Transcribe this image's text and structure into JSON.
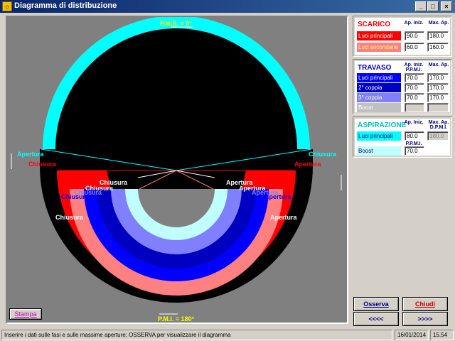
{
  "window": {
    "title": "Diagramma di distribuzione",
    "icon": "app-logo-icon",
    "minimize": "_",
    "maximize": "□",
    "close": "×"
  },
  "diagram": {
    "pms_label": "P.M.S. = 0°",
    "pmi_label": "P.M.I. = 180°",
    "left_aspirazione": "Apertura",
    "right_aspirazione": "Chiusura",
    "left_scarico": "Chiusura",
    "right_scarico": "Apertura",
    "white_close": "Chiusura",
    "white_open": "Apertura",
    "lightblue_close": "Chiusura",
    "lightblue_open": "Apertura",
    "blue_close": "Chiusura",
    "blue_open": "Apertura",
    "pink_close": "Chiusura",
    "pink_open": "Apertura",
    "print_button": "Stampa"
  },
  "scarico": {
    "title": "SCARICO",
    "col1": "Ap. Iniz.",
    "col2": "Max. Ap.",
    "rows": [
      {
        "label": "Luci principali",
        "color": "#ff0000",
        "text_color": "#ffffff",
        "ap_iniz": "90.0",
        "max_ap": "180.0"
      },
      {
        "label": "Luci secondarie",
        "color": "#ff8080",
        "text_color": "#ffff80",
        "ap_iniz": "60.0",
        "max_ap": "160.0"
      }
    ]
  },
  "travaso": {
    "title": "TRAVASO",
    "col1": "Ap. Iniz.",
    "col1b": "P.P.M.I.",
    "col2": "Max. Ap.",
    "rows": [
      {
        "label": "Luci principali",
        "color": "#0000ff",
        "text_color": "#ffffff",
        "ap_iniz": "70.0",
        "max_ap": "170.0",
        "disabled": false
      },
      {
        "label": "2° coppia",
        "color": "#0000c0",
        "text_color": "#ffffff",
        "ap_iniz": "70.0",
        "max_ap": "170.0",
        "disabled": false
      },
      {
        "label": "3° coppia",
        "color": "#8080ff",
        "text_color": "#ffff80",
        "ap_iniz": "70.0",
        "max_ap": "170.0",
        "disabled": false
      },
      {
        "label": "Boost",
        "color": "#c0c0c0",
        "text_color": "#ffffff",
        "ap_iniz": "",
        "max_ap": "",
        "disabled": true
      }
    ]
  },
  "aspirazione": {
    "title": "ASPIRAZIONE",
    "col1": "Ap. Iniz.",
    "col2": "Max. Ap.",
    "col2b": "D.P.M.I.",
    "rows": [
      {
        "label": "Luci principali",
        "color": "#00ffff",
        "text_color": "#000080",
        "ap_iniz": "80.0",
        "max_ap": "180.0",
        "sub": "P.P.M.I.",
        "max_disabled": true
      },
      {
        "label": "Boost",
        "color": "#c0ffff",
        "text_color": "#000080",
        "ap_iniz": "70.0",
        "max_ap": "",
        "sub": "",
        "max_disabled": false
      }
    ]
  },
  "buttons": {
    "osserva": "Osserva",
    "chiudi": "Chiudi",
    "prev": "<<<<",
    "next": ">>>>"
  },
  "status": {
    "message": "Inserire i dati sulle fasi e sulle massime aperture; OSSERVA per visualizzare il diagramma",
    "date": "16/01/2014",
    "time": "15.54"
  }
}
